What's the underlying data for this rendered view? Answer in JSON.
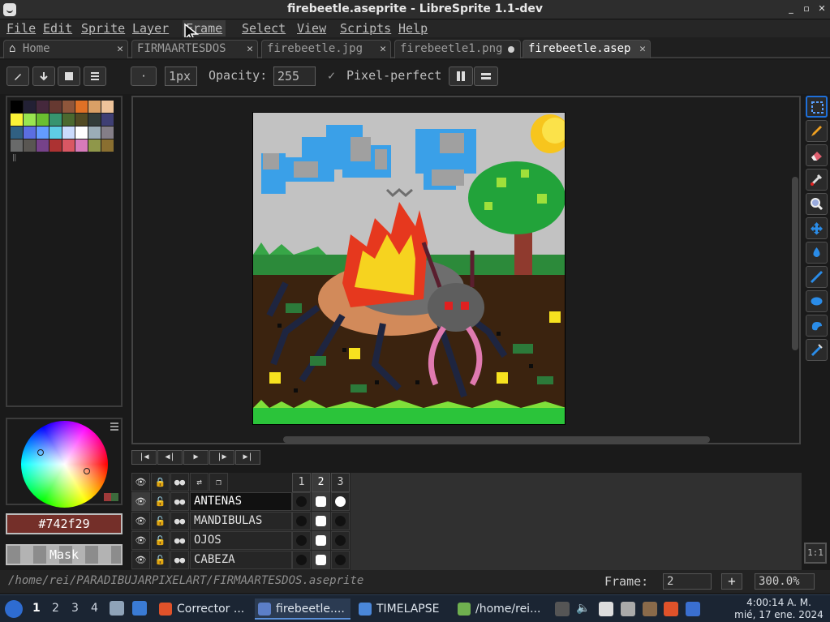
{
  "window": {
    "title": "firebeetle.aseprite - LibreSprite 1.1-dev",
    "minimize_glyph": "_",
    "maximize_glyph": "▫",
    "close_glyph": "✕"
  },
  "menu": [
    "File",
    "Edit",
    "Sprite",
    "Layer",
    "Frame",
    "Select",
    "View",
    "Scripts",
    "Help"
  ],
  "tabs": [
    {
      "label": "Home",
      "marker": "✕"
    },
    {
      "label": "FIRMAARTESDOS",
      "marker": "✕"
    },
    {
      "label": "firebeetle.jpg",
      "marker": "✕"
    },
    {
      "label": "firebeetle1.png",
      "marker": "dot"
    },
    {
      "label": "firebeetle.asep",
      "marker": "✕"
    }
  ],
  "context_bar": {
    "brush_size": "1px",
    "opacity_label": "Opacity:",
    "opacity_value": "255",
    "pixel_perfect_label": "Pixel-perfect",
    "pixel_perfect_checked": true
  },
  "palette": {
    "colors": [
      "#000000",
      "#222034",
      "#45283c",
      "#663931",
      "#8f563b",
      "#df7126",
      "#d9a066",
      "#eec39a",
      "#fbf236",
      "#99e550",
      "#6abe30",
      "#37946e",
      "#4b692f",
      "#524b24",
      "#323c39",
      "#3f3f74",
      "#306082",
      "#5b6ee1",
      "#639bff",
      "#5fcde4",
      "#cbdbfc",
      "#ffffff",
      "#9badb7",
      "#847e87",
      "#696a6a",
      "#595652",
      "#76428a",
      "#ac3232",
      "#d95763",
      "#d77bba",
      "#8f974a",
      "#8a6f30"
    ]
  },
  "color": {
    "hex": "#742f29",
    "mask_label": "Mask"
  },
  "tools": [
    "marquee-icon",
    "pencil-icon",
    "eraser-icon",
    "eyedropper-icon",
    "zoom-icon",
    "move-icon",
    "fill-icon",
    "line-icon",
    "ellipse-icon",
    "blur-icon",
    "spray-icon"
  ],
  "zoom_reset_label": "1:1",
  "timeline": {
    "frames": [
      "1",
      "2",
      "3"
    ],
    "current_frame_index": 1,
    "layers": [
      {
        "name": "ANTENAS"
      },
      {
        "name": "MANDIBULAS"
      },
      {
        "name": "OJOS"
      },
      {
        "name": "CABEZA"
      }
    ]
  },
  "status": {
    "path": "/home/rei/PARADIBUJARPIXELART/FIRMAARTESDOS.aseprite",
    "frame_label": "Frame:",
    "frame_value": "2",
    "plus_label": "+",
    "zoom_value": "300.0%"
  },
  "taskbar": {
    "workspaces": [
      "1",
      "2",
      "3",
      "4"
    ],
    "apps": [
      {
        "label": "Corrector ...",
        "color": "#e0522a"
      },
      {
        "label": "firebeetle....",
        "color": "#5c7fc8"
      },
      {
        "label": "TIMELAPSE",
        "color": "#4a87d9"
      },
      {
        "label": "/home/rei...",
        "color": "#6fb04f"
      }
    ],
    "time": "4:00:14 A. M.",
    "date": "mié, 17 ene. 2024"
  }
}
